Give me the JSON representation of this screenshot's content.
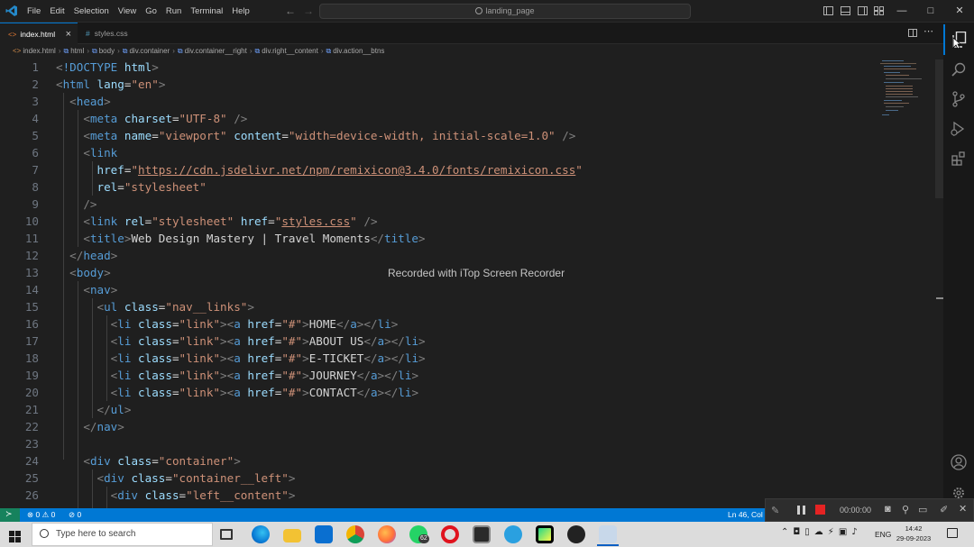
{
  "titlebar": {
    "menus": [
      "File",
      "Edit",
      "Selection",
      "View",
      "Go",
      "Run",
      "Terminal",
      "Help"
    ],
    "search_text": "landing_page"
  },
  "tabs": [
    {
      "label": "index.html",
      "active": true,
      "close": "×"
    },
    {
      "label": "styles.css",
      "active": false
    }
  ],
  "breadcrumb": [
    "index.html",
    "html",
    "body",
    "div.container",
    "div.container__right",
    "div.right__content",
    "div.action__btns"
  ],
  "line_numbers": [
    "1",
    "2",
    "3",
    "4",
    "5",
    "6",
    "7",
    "8",
    "9",
    "10",
    "11",
    "12",
    "13",
    "14",
    "15",
    "16",
    "17",
    "18",
    "19",
    "20",
    "21",
    "22",
    "23",
    "24",
    "25",
    "26"
  ],
  "watermark": "Recorded with iTop Screen Recorder",
  "statusbar": {
    "errors": "0",
    "warnings": "0",
    "ports": "0",
    "position": "Ln 46, Col"
  },
  "recorder": {
    "time": "00:00:00"
  },
  "taskbar": {
    "search_placeholder": "Type here to search",
    "whatsapp_badge": "62",
    "language": "ENG",
    "time": "14:42",
    "date": "29-09-2023"
  },
  "colors": {
    "statusbar": "#0078d4",
    "editor_bg": "#1f1f1f",
    "tag": "#569cd6",
    "attr": "#9cdcfe",
    "string": "#ce9178"
  },
  "icons": {
    "titlebar": [
      "vscode-logo-icon",
      "back-arrow-icon",
      "forward-arrow-icon",
      "search-icon",
      "toggle-primary-sidebar-icon",
      "toggle-panel-icon",
      "toggle-secondary-sidebar-icon",
      "customize-layout-icon",
      "minimize-icon",
      "maximize-icon",
      "close-icon"
    ],
    "activitybar": [
      "explorer-icon",
      "search-icon",
      "source-control-icon",
      "run-debug-icon",
      "extensions-icon",
      "accounts-icon",
      "manage-gear-icon"
    ]
  }
}
